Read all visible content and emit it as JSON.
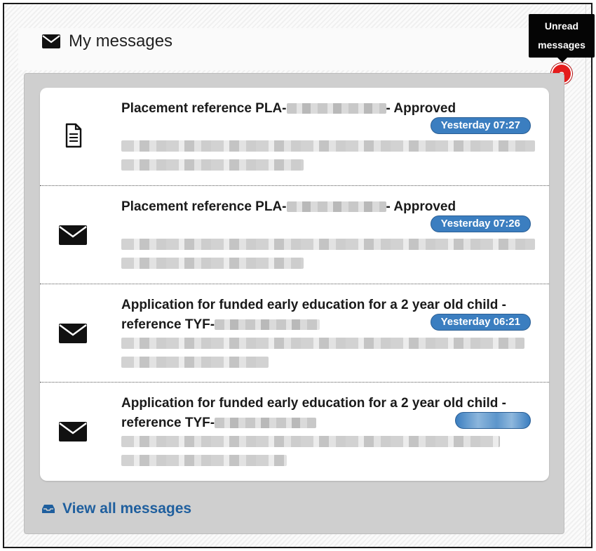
{
  "header": {
    "title": "My messages",
    "icon": "envelope-icon"
  },
  "unread": {
    "tooltip_line1": "Unread",
    "tooltip_line2": "messages",
    "count": "3"
  },
  "messages": [
    {
      "title_prefix": "Placement reference PLA-",
      "title_suffix": "- Approved",
      "date": "Yesterday 07:27",
      "icon": "document-icon"
    },
    {
      "title_prefix": "Placement reference PLA-",
      "title_suffix": "- Approved",
      "date": "Yesterday 07:26",
      "icon": "envelope-icon"
    },
    {
      "title_line1": "Application for funded early education for a 2 year old child -",
      "title_prefix": "reference TYF-",
      "date": "Yesterday 06:21",
      "icon": "envelope-icon"
    },
    {
      "title_line1": "Application for funded early education for a 2 year old child -",
      "title_prefix": "reference TYF-",
      "date": "",
      "icon": "envelope-icon"
    }
  ],
  "footer": {
    "view_all": "View all messages",
    "icon": "inbox-icon"
  },
  "colors": {
    "accent": "#3b7ec0",
    "link": "#1f5f9e",
    "badge": "#e41c1c"
  }
}
